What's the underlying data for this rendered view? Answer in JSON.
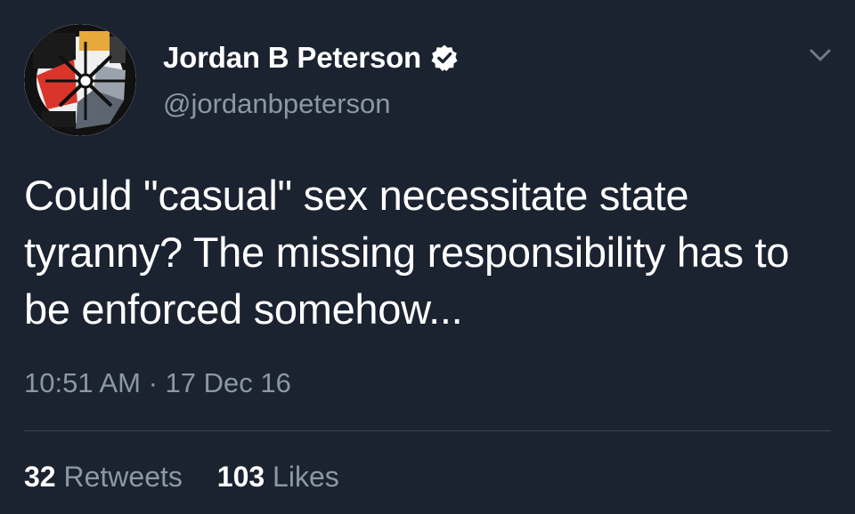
{
  "author": {
    "display_name": "Jordan B Peterson",
    "handle": "@jordanbpeterson",
    "verified": true,
    "avatar_icon": "geometric-emblem-avatar"
  },
  "tweet": {
    "text": "Could \"casual\" sex necessitate state tyranny? The missing responsibility has to be enforced somehow...",
    "timestamp": "10:51 AM · 17 Dec 16"
  },
  "stats": {
    "retweets_count": "32",
    "retweets_label": "Retweets",
    "likes_count": "103",
    "likes_label": "Likes"
  },
  "colors": {
    "background": "#1b2230",
    "text_primary": "#ffffff",
    "text_secondary": "#8b98a5",
    "verified_badge": "#ffffff"
  },
  "icons": {
    "verified": "verified-badge-icon",
    "more_options": "chevron-down-icon"
  }
}
